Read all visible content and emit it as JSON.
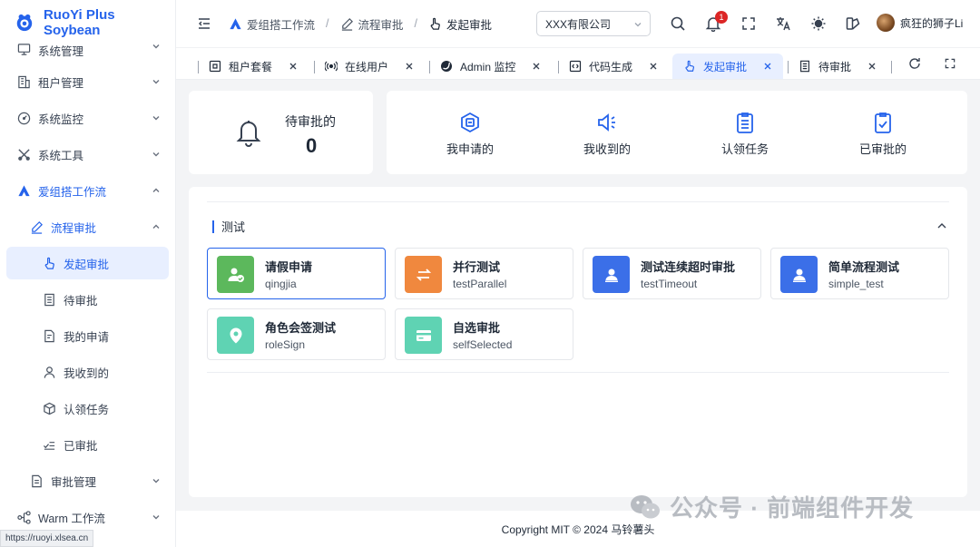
{
  "app": {
    "name": "RuoYi Plus Soybean"
  },
  "sidebar": {
    "items": [
      {
        "label": "系统管理",
        "icon": "monitor-gear-icon"
      },
      {
        "label": "租户管理",
        "icon": "building-icon"
      },
      {
        "label": "系统监控",
        "icon": "gauge-icon"
      },
      {
        "label": "系统工具",
        "icon": "tools-icon"
      },
      {
        "label": "爱组搭工作流",
        "icon": "workflow-logo-icon"
      },
      {
        "label": "流程审批",
        "icon": "pen-icon"
      },
      {
        "label": "发起审批",
        "icon": "hand-pointer-icon"
      },
      {
        "label": "待审批",
        "icon": "list-doc-icon"
      },
      {
        "label": "我的申请",
        "icon": "doc-user-icon"
      },
      {
        "label": "我收到的",
        "icon": "user-icon"
      },
      {
        "label": "认领任务",
        "icon": "cube-icon"
      },
      {
        "label": "已审批",
        "icon": "check-list-icon"
      },
      {
        "label": "审批管理",
        "icon": "doc-icon"
      },
      {
        "label": "Warm 工作流",
        "icon": "flow-icon"
      }
    ]
  },
  "header": {
    "breadcrumbs": [
      "爱组搭工作流",
      "流程审批",
      "发起审批"
    ],
    "company": "XXX有限公司",
    "notification_count": "1",
    "user_name": "疯狂的狮子Li"
  },
  "tabs": [
    {
      "label": "租户套餐",
      "icon": "package-icon"
    },
    {
      "label": "在线用户",
      "icon": "broadcast-icon"
    },
    {
      "label": "Admin 监控",
      "icon": "spring-icon"
    },
    {
      "label": "代码生成",
      "icon": "code-icon"
    },
    {
      "label": "发起审批",
      "icon": "hand-pointer-icon"
    },
    {
      "label": "待审批",
      "icon": "list-doc-icon"
    }
  ],
  "summary": {
    "pending_label": "待审批的",
    "pending_count": "0",
    "quick": [
      {
        "label": "我申请的",
        "icon": "send-icon"
      },
      {
        "label": "我收到的",
        "icon": "speaker-icon"
      },
      {
        "label": "认领任务",
        "icon": "clipboard-list-icon"
      },
      {
        "label": "已审批的",
        "icon": "clipboard-check-icon"
      }
    ]
  },
  "section": {
    "title": "测试",
    "flows": [
      {
        "name": "请假申请",
        "key": "qingjia",
        "color": "#5cb85c",
        "icon": "user-check-icon"
      },
      {
        "name": "并行测试",
        "key": "testParallel",
        "color": "#f0883e",
        "icon": "swap-icon"
      },
      {
        "name": "测试连续超时审批",
        "key": "testTimeout",
        "color": "#3b6fe8",
        "icon": "portrait-icon"
      },
      {
        "name": "简单流程测试",
        "key": "simple_test",
        "color": "#3b6fe8",
        "icon": "portrait-icon"
      },
      {
        "name": "角色会签测试",
        "key": "roleSign",
        "color": "#5fd3b3",
        "icon": "location-icon"
      },
      {
        "name": "自选审批",
        "key": "selfSelected",
        "color": "#5fd3b3",
        "icon": "card-icon"
      }
    ]
  },
  "footer": {
    "copyright": "Copyright MIT © 2024 马铃薯头"
  },
  "status_url": "https://ruoyi.xlsea.cn",
  "overlay": {
    "brand": "公众号 · 前端组件开发"
  }
}
